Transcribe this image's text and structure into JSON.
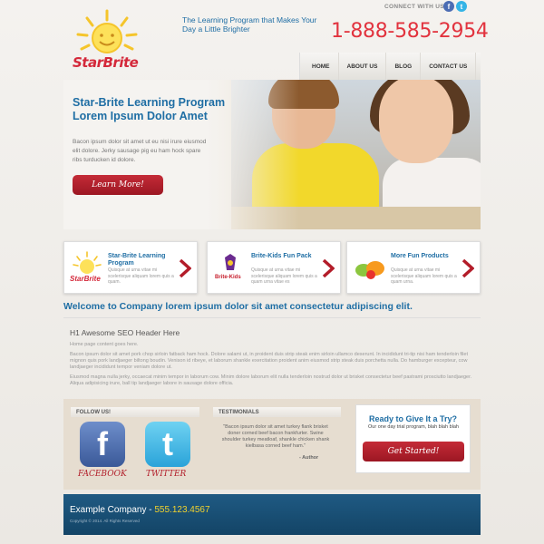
{
  "header": {
    "connect_label": "CONNECT WITH US:",
    "social_icons": [
      "facebook-icon",
      "twitter-icon"
    ],
    "logo_text": "StarBrite",
    "tagline": "The Learning Program that Makes Your Day a Little Brighter",
    "phone": "1-888-585-2954",
    "nav": [
      "HOME",
      "ABOUT US",
      "BLOG",
      "CONTACT US"
    ]
  },
  "hero": {
    "title": "Star-Brite Learning Program Lorem Ipsum Dolor Amet",
    "text": "Bacon ipsum dolor sit amet ut eu nisi irure eiusmod elit dolore. Jerky sausage pig eu ham hock spare ribs turducken id dolore.",
    "button": "Learn More!"
  },
  "cards": [
    {
      "title": "Star-Brite Learning Program",
      "text": "Quisque at urna vitae mi scelerisque aliquam lorem quis a quam.",
      "logo": "StarBrite",
      "icon": "sun-logo-icon"
    },
    {
      "title": "Brite-Kids Fun Pack",
      "text": "Quisque at urna vitae mi scelerisque aliquam lorem quis a quam urna vitae es",
      "logo": "Brite-Kids",
      "icon": "brite-kids-logo-icon"
    },
    {
      "title": "More Fun Products",
      "text": "Quisque at urna vitae mi scelerisque aliquam lorem quis a quam urna.",
      "icon": "fruit-icon"
    }
  ],
  "welcome": "Welcome to Company lorem ipsum dolor sit amet consectetur adipiscing elit.",
  "seo": {
    "header": "H1 Awesome SEO Header Here",
    "intro": "Home page content goes here.",
    "p1": "Bacon ipsum dolor sit amet pork chop sirloin fatback ham hock. Dolore salami ut, in proident duis strip steak enim sirloin ullamco deserunt. In incididunt tri-tip nisi ham tenderloin filet mignon quis pork landjaeger biltong boudin. Venison id ribeye, et laborum shankle exercitation proident anim eiusmod strip steak duis porchetta nulla. Do hamburger excepteur, cow landjaeger incididunt tempor veniam dolore ut.",
    "p2": "Eiusmod magna nulla jerky, occaecat minim tempor in laborum cow. Minim dolore laborum elit nulla tenderloin nostrud dolor ut brisket consectetur beef pastrami prosciutto landjaeger. Aliqua adipisicing irure, ball tip landjaeger labore in sausage dolore officia."
  },
  "follow": {
    "title": "FOLLOW US!",
    "facebook_label": "FACEBOOK",
    "twitter_label": "TWITTER"
  },
  "testimonials": {
    "title": "TESTIMONIALS",
    "quote": "\"Bacon ipsum dolor sit amet turkey flank brisket doner corned beef bacon frankfurter. Swine shoulder turkey meatloaf, shankle chicken shank kielbasa corned beef ham.\"",
    "author": "- Author"
  },
  "cta": {
    "title": "Ready to Give It a Try?",
    "text": "Our one day trial program, blah blah blah",
    "button": "Get Started!"
  },
  "footer": {
    "company": "Example Company -",
    "phone": "555.123.4567",
    "copyright": "Copyright © 2014. All Rights Reserved"
  },
  "colors": {
    "accent_blue": "#1f6ea4",
    "accent_red": "#c42b37",
    "footer_blue": "#1f5a83",
    "phone_red": "#e2333e"
  }
}
